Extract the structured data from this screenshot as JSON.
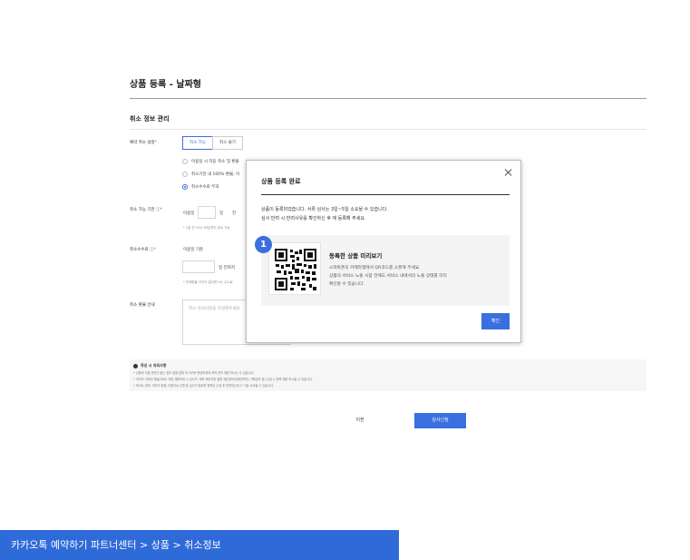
{
  "page": {
    "title": "상품 등록 - 날짜형",
    "section_title": "취소 정보 관리"
  },
  "cancel_setting": {
    "label": "예약 취소 설정",
    "required_mark": "*",
    "options": [
      "취소 가능",
      "취소 불가"
    ],
    "radios": [
      "이용일 시 자동 취소 및 환불",
      "취소기한 내 100% 환불, 이",
      "취소수수료 부과"
    ]
  },
  "cancel_deadline": {
    "label": "취소 가능 기한",
    "required_mark": "*",
    "prefix": "이용일",
    "unit_day": "일",
    "unit_before": "전",
    "note": "* 1일 전 23시 59분까지 취소 가능"
  },
  "cancel_fee": {
    "label": "취소수수료",
    "required_mark": "*",
    "basis": "이용일 기준",
    "unit": "일 전까지",
    "note": "* 전액환불 구간이 없다면 0% 수수료"
  },
  "refund_guide": {
    "label": "취소 환불 안내",
    "placeholder": "취소 유의사항을 작성해주세요"
  },
  "notes": {
    "title": "작성 시 유의사항",
    "lines": [
      "• 상품과 직접 관련이 없는 정보 설명 업체 외 이커브 운영자에게 부탁 문의 제한 하시는 수 있습니다.",
      "• 카카오 이외의 채널(SNS) 직원 제휴처와 시 있으므, 예약 페이지를 통한 제안정보(대체연락처, 카톡링크 등) 수집 시 정책 제한 하시될 수 있습니다.",
      "• 하소트 입력, 이미지 등록, 이용가능 인원 등 심사가 필요한 항목은 수정 후 반영되는데 2~3일 소요될 수 있습니다."
    ]
  },
  "actions": {
    "prev": "이전",
    "submit": "심사신청"
  },
  "modal": {
    "title": "상품 등록 완료",
    "message_line1": "상품이 등록되었습니다. 서류 심사는 3일~5일 소요될 수 있습니다.",
    "message_line2": "심사 반려 시 반려사유를 확인하신 후 재 등록해 주세요.",
    "badge_number": "1",
    "preview_title": "등록한 상품 미리보기",
    "preview_lines": [
      "스마트폰의 카메라앱에서 QR코드를 스캔해 주세요.",
      "상품의 서비스 노출 시점 전에도 서비스 내에서의 노출 상태를 미리",
      "확인할 수 있습니다."
    ],
    "ok": "확인"
  },
  "footer": {
    "breadcrumb": "카카오톡 예약하기 파트너센터 > 상품 > 취소정보"
  },
  "colors": {
    "accent": "#3b6fe0",
    "footer_bg": "#2f6ad9"
  }
}
